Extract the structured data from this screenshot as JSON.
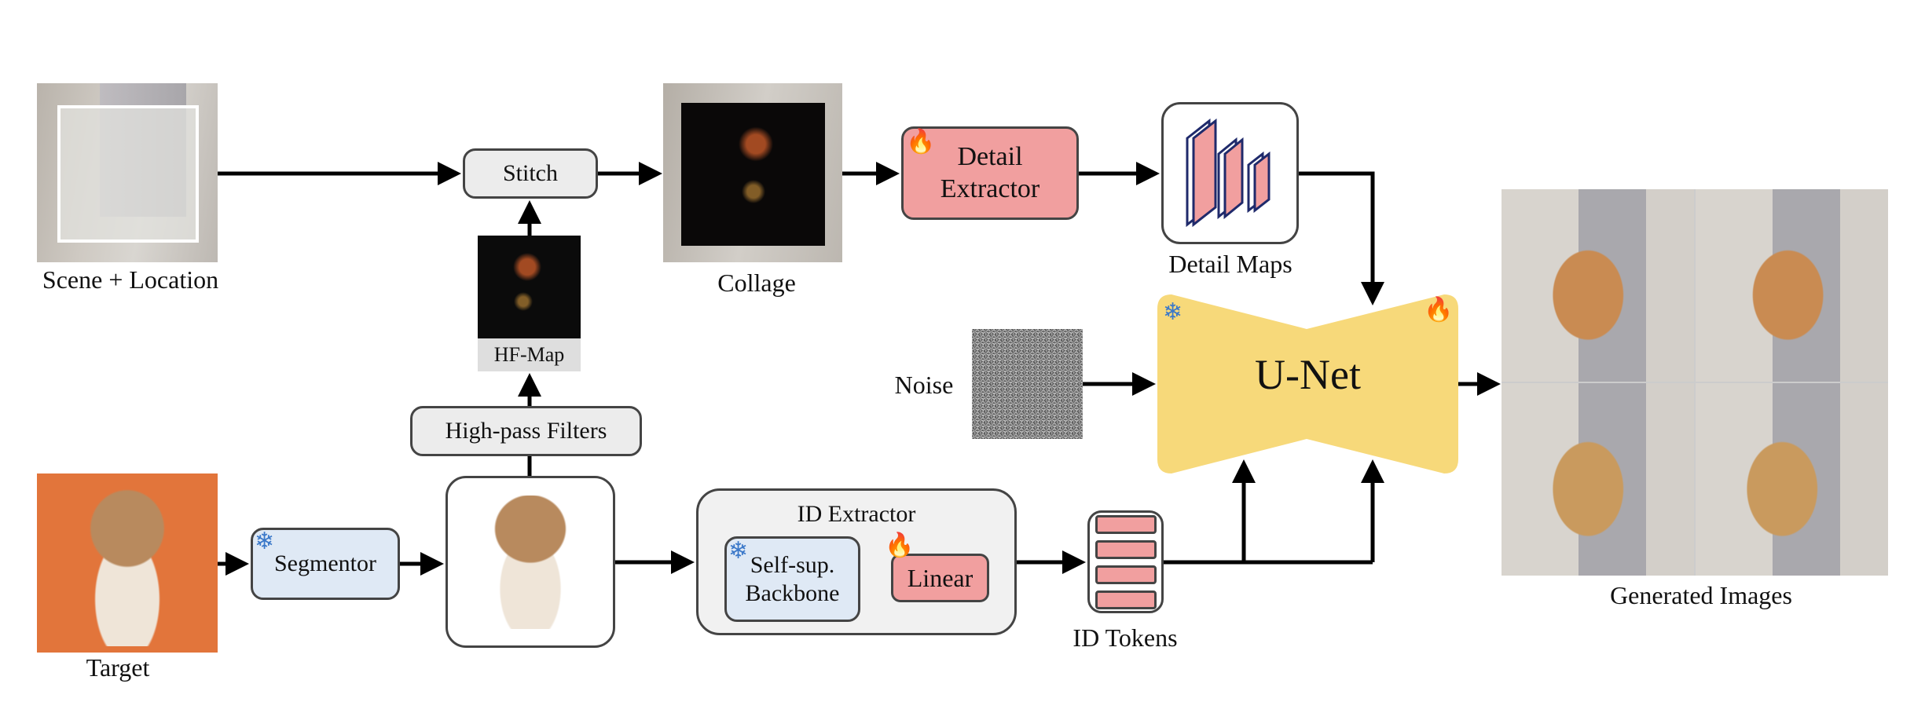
{
  "diagram": {
    "inputs": {
      "scene_label": "Scene + Location",
      "target_label": "Target",
      "noise_label": "Noise"
    },
    "modules": {
      "stitch": "Stitch",
      "hf_map": "HF-Map",
      "high_pass": "High-pass Filters",
      "collage": "Collage",
      "detail_extractor_line1": "Detail",
      "detail_extractor_line2": "Extractor",
      "detail_maps": "Detail Maps",
      "unet": "U-Net",
      "segmentor": "Segmentor",
      "id_extractor": "ID Extractor",
      "backbone_line1": "Self-sup.",
      "backbone_line2": "Backbone",
      "linear": "Linear",
      "id_tokens": "ID Tokens",
      "generated": "Generated Images"
    },
    "icons": {
      "frozen": "snowflake-icon",
      "trainable": "fire-icon",
      "frozen_glyph": "❄",
      "trainable_glyph": "🔥"
    },
    "colors": {
      "trainable_fill": "#f19f9f",
      "frozen_fill": "#dfe9f5",
      "neutral_fill": "#ececec",
      "unet_fill": "#f7d97a",
      "arrow": "#000000"
    }
  }
}
